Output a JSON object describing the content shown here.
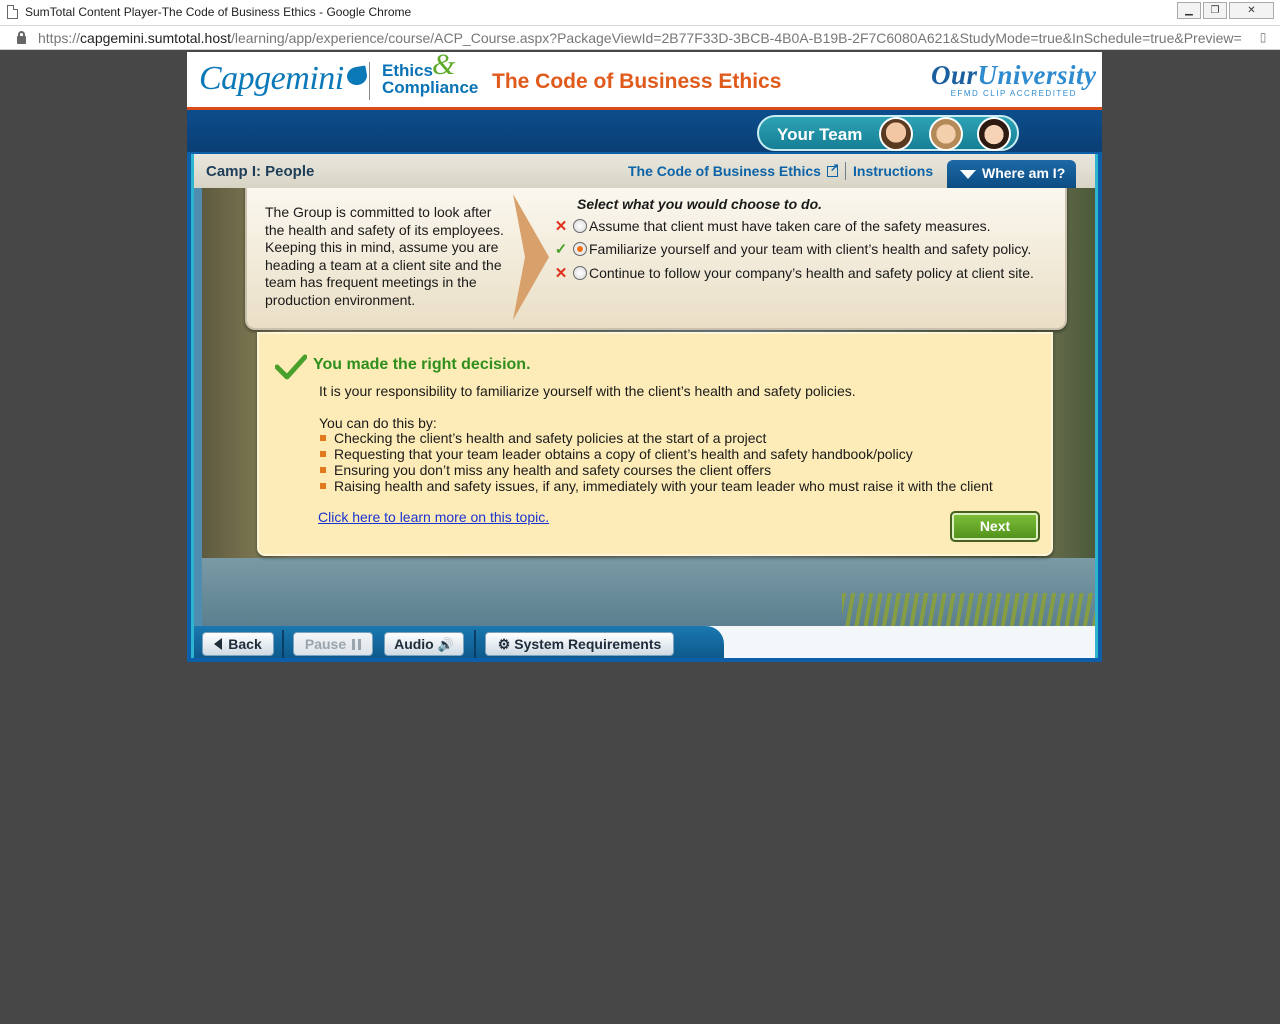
{
  "browser": {
    "window_title": "SumTotal Content Player-The Code of Business Ethics - Google Chrome",
    "url_scheme": "https://",
    "url_host": "capgemini.sumtotal.host",
    "url_path": "/learning/app/experience/course/ACP_Course.aspx?PackageViewId=2B77F33D-3BCB-4B0A-B19B-2F7C6080A621&StudyMode=true&InSchedule=true&Preview=...",
    "window_buttons": [
      "minimize",
      "restore",
      "close"
    ]
  },
  "header": {
    "brand": "Capgemini",
    "ec_line1": "Ethics",
    "ec_amp": "&",
    "ec_line2": "Compliance",
    "course_title": "The Code of Business Ethics",
    "ou_our": "Our",
    "ou_university": "University",
    "ou_sub": "EFMD CLIP ACCREDITED"
  },
  "team": {
    "label": "Your Team"
  },
  "nav": {
    "camp_title": "Camp I: People",
    "code_link": "The Code of Business Ethics",
    "instructions": "Instructions",
    "where_am_i": "Where am I?"
  },
  "question": {
    "scenario": "The Group is committed to look after the health and safety of its employees. Keeping this in mind, assume you are heading a team at a client site and the team has frequent meetings in the production environment.",
    "prompt": "Select what you would choose to do.",
    "options": [
      {
        "label": "Assume that client must have taken care of the safety measures.",
        "mark": "✕",
        "selected": false
      },
      {
        "label": "Familiarize yourself and your team with client’s health and safety policy.",
        "mark": "✓",
        "selected": true
      },
      {
        "label": "Continue to follow your company’s health and safety policy at client site.",
        "mark": "✕",
        "selected": false
      }
    ]
  },
  "feedback": {
    "heading": "You made the right decision.",
    "body": "It is your responsibility to familiarize yourself with the client’s health and safety policies.",
    "intro": "You can do this by:",
    "items": [
      "Checking the client’s health and safety policies at the start of a project",
      "Requesting that your team leader obtains a copy of client’s health and safety handbook/policy",
      "Ensuring you don’t miss any health and safety courses the client offers",
      "Raising health and safety issues, if any, immediately with your team leader who must raise it with the client"
    ],
    "link": "Click here to learn more on this topic.",
    "next": "Next"
  },
  "controls": {
    "back": "Back",
    "pause": "Pause",
    "audio": "Audio",
    "system_requirements": "System Requirements"
  }
}
